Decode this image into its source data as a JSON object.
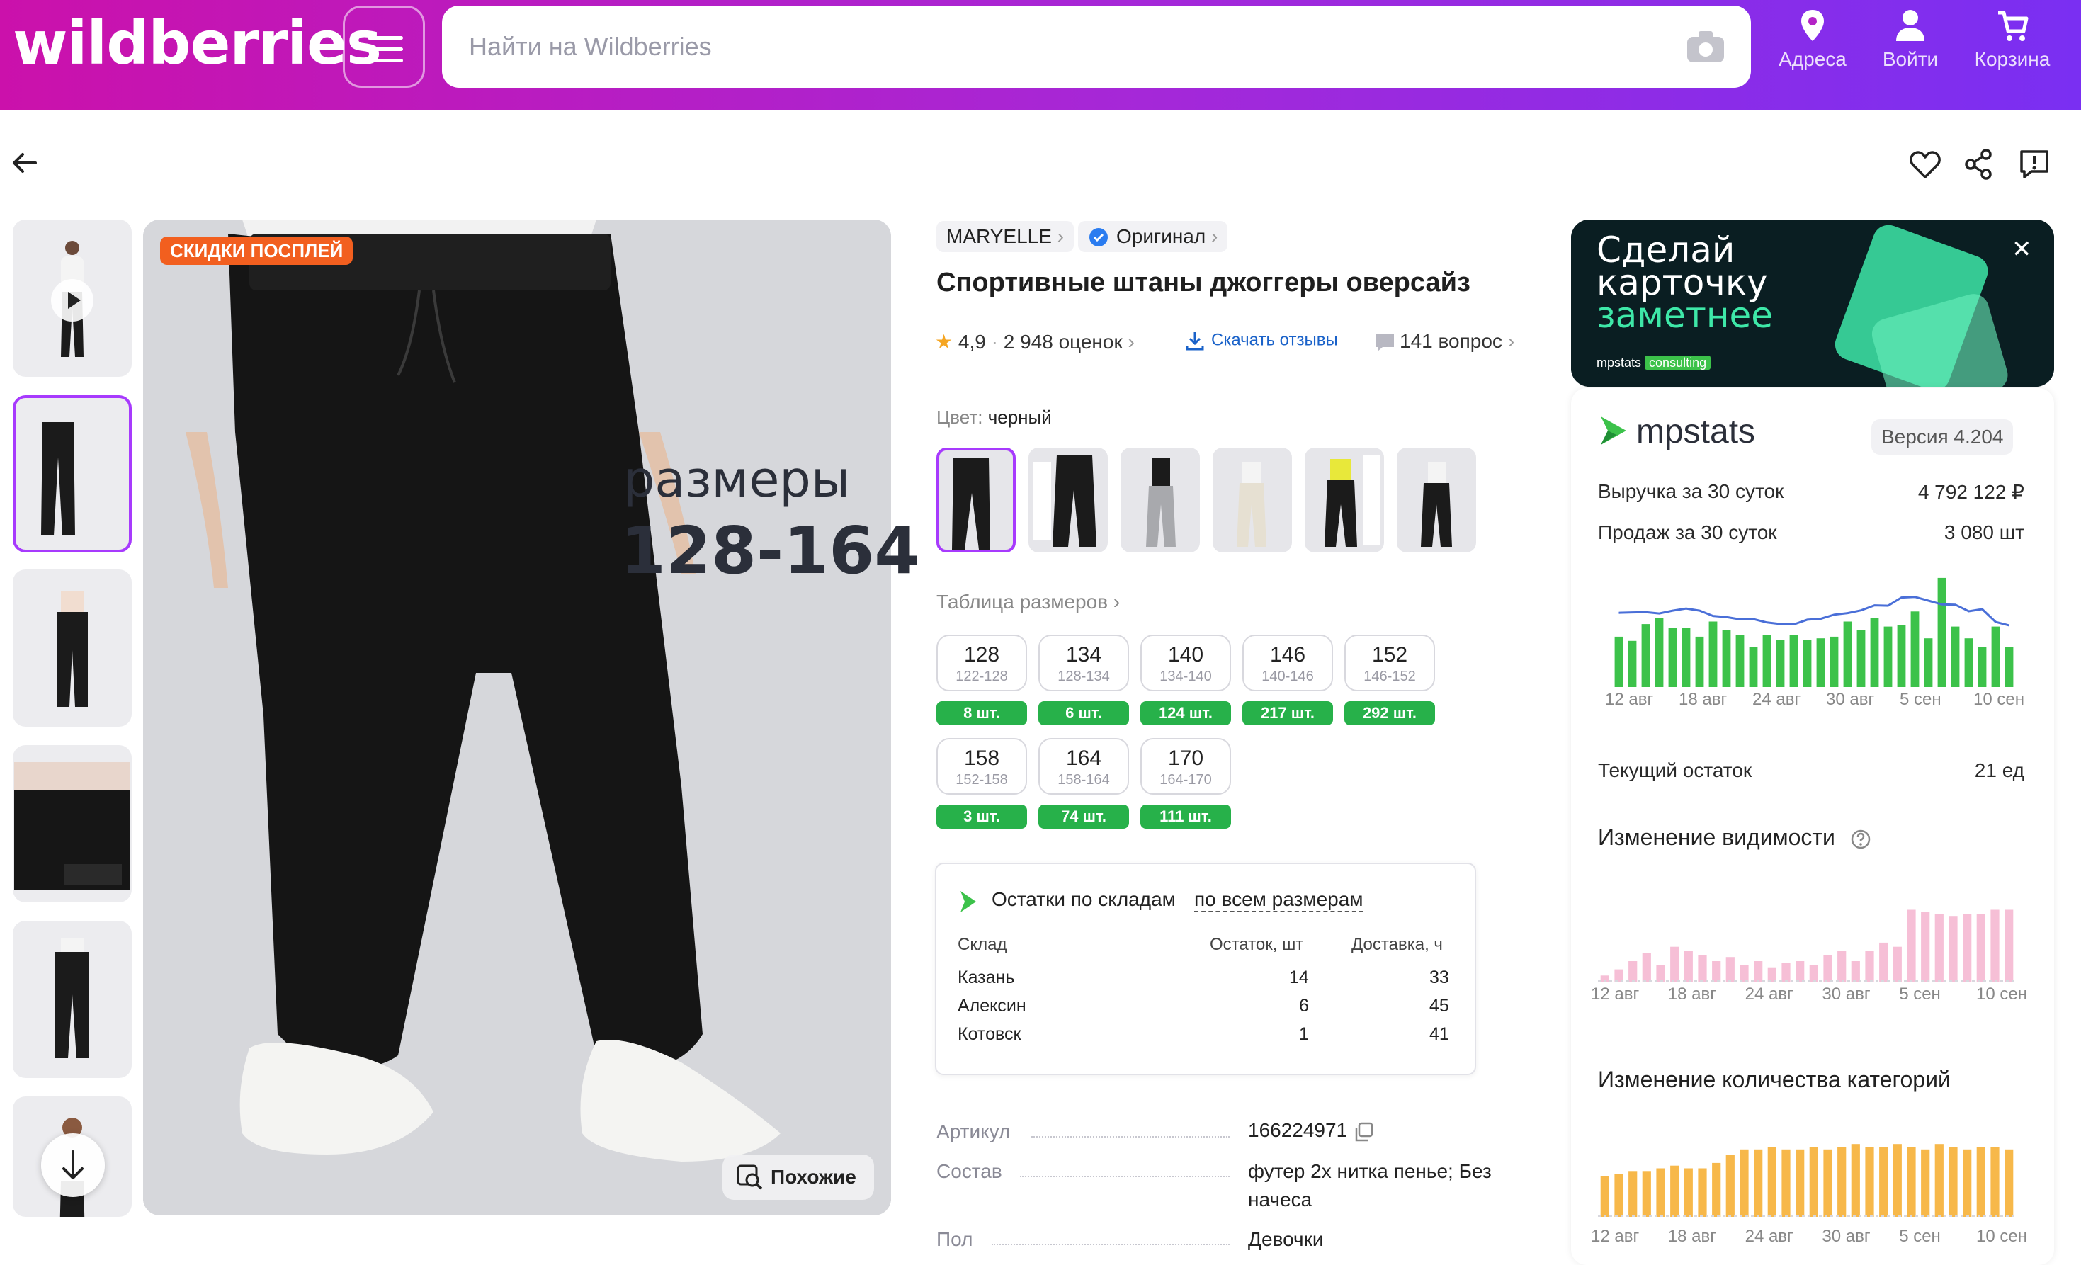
{
  "header": {
    "logo": "wildberries",
    "search_placeholder": "Найти на Wildberries",
    "addresses": "Адреса",
    "login": "Войти",
    "cart": "Корзина"
  },
  "gallery": {
    "promo_badge": "Скидки Посплей",
    "image_text_line1": "размеры",
    "image_text_line2": "128-164",
    "similar_button": "Похожие"
  },
  "product": {
    "brand": "MARYELLE",
    "original": "Оригинал",
    "title": "Спортивные штаны джоггеры оверсайз",
    "rating": "4,9",
    "reviews": "2 948 оценок",
    "download_reviews": "Скачать отзывы",
    "questions": "141 вопрос",
    "color_label": "Цвет:",
    "color_value": "черный",
    "size_table": "Таблица размеров",
    "sizes": [
      {
        "size": "128",
        "range": "122-128",
        "stock": "8 шт."
      },
      {
        "size": "134",
        "range": "128-134",
        "stock": "6 шт."
      },
      {
        "size": "140",
        "range": "134-140",
        "stock": "124 шт."
      },
      {
        "size": "146",
        "range": "140-146",
        "stock": "217 шт."
      },
      {
        "size": "152",
        "range": "146-152",
        "stock": "292 шт."
      },
      {
        "size": "158",
        "range": "152-158",
        "stock": "3 шт."
      },
      {
        "size": "164",
        "range": "158-164",
        "stock": "74 шт."
      },
      {
        "size": "170",
        "range": "164-170",
        "stock": "111 шт."
      }
    ]
  },
  "warehouses": {
    "title": "Остатки по складам",
    "switch": "по всем размерам",
    "headers": [
      "Склад",
      "Остаток, шт",
      "Доставка, ч"
    ],
    "rows": [
      [
        "Казань",
        "14",
        "33"
      ],
      [
        "Алексин",
        "6",
        "45"
      ],
      [
        "Котовск",
        "1",
        "41"
      ]
    ]
  },
  "specs": {
    "article_label": "Артикул",
    "article_value": "166224971",
    "composition_label": "Состав",
    "composition_value_1": "футер 2х нитка пенье; Без",
    "composition_value_2": "начеса",
    "gender_label": "Пол",
    "gender_value": "Девочки"
  },
  "ad": {
    "line1": "Сделай",
    "line2": "карточку",
    "line3": "заметнее",
    "brand": "mpstats",
    "tag": "consulting"
  },
  "mpstats": {
    "logo": "mpstats",
    "version": "Версия 4.204",
    "revenue_label": "Выручка за 30 суток",
    "revenue_value": "4 792 122 ₽",
    "sales_label": "Продаж за 30 суток",
    "sales_value": "3 080 шт",
    "stock_label": "Текущий остаток",
    "stock_value": "21 ед",
    "visibility_title": "Изменение видимости",
    "categories_title": "Изменение количества категорий",
    "axis": [
      "12 авг",
      "18 авг",
      "24 авг",
      "30 авг",
      "5 сен",
      "10 сен"
    ]
  },
  "chart_data": [
    {
      "type": "bar",
      "title": "",
      "categories": [
        "12 авг",
        "13 авг",
        "14 авг",
        "15 авг",
        "16 авг",
        "17 авг",
        "18 авг",
        "19 авг",
        "20 авг",
        "21 авг",
        "22 авг",
        "23 авг",
        "24 авг",
        "25 авг",
        "26 авг",
        "27 авг",
        "28 авг",
        "29 авг",
        "30 авг",
        "31 авг",
        "1 сен",
        "2 сен",
        "3 сен",
        "4 сен",
        "5 сен",
        "6 сен",
        "7 сен",
        "8 сен",
        "9 сен",
        "10 сен"
      ],
      "values": [
        60,
        55,
        75,
        82,
        70,
        70,
        60,
        78,
        68,
        62,
        48,
        62,
        56,
        62,
        56,
        58,
        60,
        78,
        68,
        82,
        72,
        74,
        90,
        58,
        130,
        72,
        58,
        48,
        72,
        48
      ],
      "colors": {
        "bars": "#3cc24a",
        "line": "#4a6fd8"
      }
    },
    {
      "type": "bar",
      "title": "Изменение видимости",
      "categories": [
        "12 авг",
        "13 авг",
        "14 авг",
        "15 авг",
        "16 авг",
        "17 авг",
        "18 авг",
        "19 авг",
        "20 авг",
        "21 авг",
        "22 авг",
        "23 авг",
        "24 авг",
        "25 авг",
        "26 авг",
        "27 авг",
        "28 авг",
        "29 авг",
        "30 авг",
        "31 авг",
        "1 сен",
        "2 сен",
        "3 сен",
        "4 сен",
        "5 сен",
        "6 сен",
        "7 сен",
        "8 сен",
        "9 сен",
        "10 сен"
      ],
      "values": [
        6,
        12,
        20,
        28,
        16,
        34,
        30,
        26,
        20,
        24,
        16,
        20,
        14,
        18,
        20,
        16,
        26,
        30,
        20,
        30,
        38,
        34,
        70,
        68,
        66,
        64,
        66,
        66,
        70,
        70
      ],
      "colors": {
        "bars": "#f6bfd6"
      }
    },
    {
      "type": "bar",
      "title": "Изменение количества категорий",
      "categories": [
        "12 авг",
        "13 авг",
        "14 авг",
        "15 авг",
        "16 авг",
        "17 авг",
        "18 авг",
        "19 авг",
        "20 авг",
        "21 авг",
        "22 авг",
        "23 авг",
        "24 авг",
        "25 авг",
        "26 авг",
        "27 авг",
        "28 авг",
        "29 авг",
        "30 авг",
        "31 авг",
        "1 сен",
        "2 сен",
        "3 сен",
        "4 сен",
        "5 сен",
        "6 сен",
        "7 сен",
        "8 сен",
        "9 сен",
        "10 сен"
      ],
      "values": [
        30,
        32,
        34,
        34,
        36,
        38,
        36,
        36,
        40,
        46,
        50,
        50,
        52,
        50,
        50,
        52,
        50,
        52,
        54,
        52,
        52,
        54,
        52,
        50,
        54,
        52,
        50,
        52,
        52,
        50
      ],
      "colors": {
        "bars": "#f7b84a"
      }
    }
  ]
}
